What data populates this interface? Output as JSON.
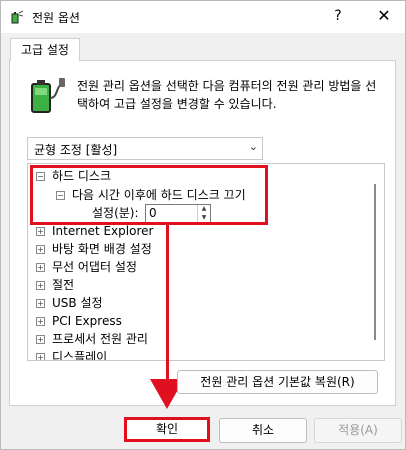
{
  "window": {
    "title": "전원 옵션",
    "help_label": "?",
    "close_label": "✕"
  },
  "tab": {
    "label": "고급 설정"
  },
  "description": "전원 관리 옵션을 선택한 다음 컴퓨터의 전원 관리 방법을 선택하여 고급 설정을 변경할 수 있습니다.",
  "plan_select": {
    "value": "균형 조정 [활성]"
  },
  "tree": {
    "hard_disk": {
      "label": "하드 디스크",
      "toggle": "−"
    },
    "turn_off_disk": {
      "label": "다음 시간 이후에 하드 디스크 끄기",
      "toggle": "−"
    },
    "setting": {
      "label": "설정(분):",
      "value": "0"
    },
    "items": [
      {
        "label": "Internet Explorer"
      },
      {
        "label": "바탕 화면 배경 설정"
      },
      {
        "label": "무선 어댑터 설정"
      },
      {
        "label": "절전"
      },
      {
        "label": "USB 설정"
      },
      {
        "label": "PCI Express"
      },
      {
        "label": "프로세서 전원 관리"
      },
      {
        "label": "디스플레이"
      }
    ],
    "expand_glyph": "+"
  },
  "buttons": {
    "restore": "전원 관리 옵션 기본값 복원(R)",
    "ok": "확인",
    "cancel": "취소",
    "apply": "적용(A)"
  },
  "colors": {
    "highlight": "#e01020",
    "battery": "#3cb043"
  },
  "icons": {
    "title": "power-options-icon",
    "description": "battery-plug-icon"
  }
}
